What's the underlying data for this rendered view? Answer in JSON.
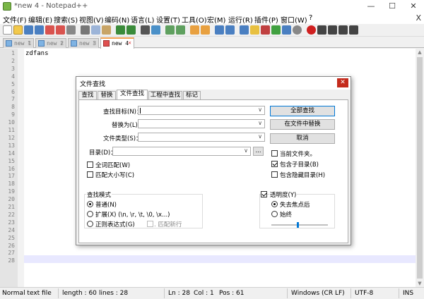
{
  "window": {
    "title": "*new 4 - Notepad++",
    "min": "—",
    "max": "☐",
    "close": "✕"
  },
  "menu": [
    "文件(F)",
    "编辑(E)",
    "搜索(S)",
    "视图(V)",
    "编码(N)",
    "语言(L)",
    "设置(T)",
    "工具(O)",
    "宏(M)",
    "运行(R)",
    "插件(P)",
    "窗口(W)",
    "?"
  ],
  "menu_close": "X",
  "tabs": [
    {
      "label": "new 1",
      "close": "✕"
    },
    {
      "label": "new 2",
      "close": "✕"
    },
    {
      "label": "new 3",
      "close": "✕"
    },
    {
      "label": "new 4",
      "close": "✕"
    }
  ],
  "editor": {
    "line_numbers": [
      "1",
      "2",
      "3",
      "4",
      "5",
      "6",
      "7",
      "8",
      "9",
      "10",
      "11",
      "12",
      "13",
      "14",
      "15",
      "16",
      "17",
      "18",
      "19",
      "20",
      "21",
      "22",
      "23",
      "24",
      "25",
      "26",
      "27",
      "28"
    ],
    "first_line_text": "zdfans",
    "current_line_bg": "#e8e8ff"
  },
  "status": {
    "type": "Normal text file",
    "length": "length : 60",
    "lines": "lines : 28",
    "ln": "Ln : 28",
    "col": "Col : 1",
    "pos": "Pos : 61",
    "eol": "Windows (CR LF)",
    "encoding": "UTF-8",
    "mode": "INS"
  },
  "dialog": {
    "title": "文件查找",
    "close": "✕",
    "tabs": [
      "查找",
      "替换",
      "文件查找",
      "工程中查找",
      "标记"
    ],
    "active_tab": "文件查找",
    "find_label": "查找目标(N)：",
    "replace_label": "替换为(L)：",
    "filter_label": "文件类型(S)：",
    "dir_label": "目录(D)：",
    "browse_label": "...",
    "find_all_button": "全部查找",
    "replace_in_files_button": "在文件中替换",
    "cancel_button": "取消",
    "match_whole_word": "全词匹配(W)",
    "match_case": "匹配大小写(C)",
    "current_folder": "当前文件夹。",
    "in_subfolders": "包含子目录(B)",
    "in_hidden": "包含隐藏目录(H)",
    "search_mode_title": "查找模式",
    "mode_normal": "普通(N)",
    "mode_extended": "扩展(X) (\\n, \\r, \\t, \\0, \\x...)",
    "mode_regex": "正则表达式(G)",
    "matches_newline": ". 匹配新行",
    "transparency": "透明度(Y)",
    "on_losing_focus": "失去焦点后",
    "always": "始终",
    "transparency_level": 0.45
  }
}
